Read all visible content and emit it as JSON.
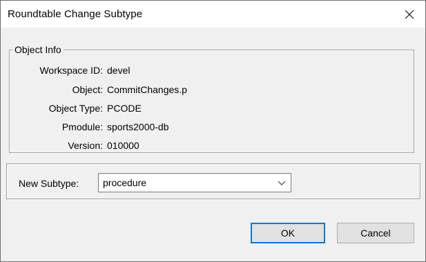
{
  "window": {
    "title": "Roundtable Change Subtype",
    "close_glyph": "✕"
  },
  "object_info": {
    "legend": "Object Info",
    "rows": [
      {
        "label": "Workspace ID:",
        "value": "devel"
      },
      {
        "label": "Object:",
        "value": "CommitChanges.p"
      },
      {
        "label": "Object Type:",
        "value": "PCODE"
      },
      {
        "label": "Pmodule:",
        "value": "sports2000-db"
      },
      {
        "label": "Version:",
        "value": "010000"
      }
    ]
  },
  "subtype": {
    "label": "New Subtype:",
    "selected": "procedure"
  },
  "buttons": {
    "ok": "OK",
    "cancel": "Cancel"
  },
  "icons": {
    "close": "close-icon",
    "dropdown": "chevron-down-icon"
  },
  "colors": {
    "focus_border": "#0078d7",
    "dialog_bg": "#f0f0f0",
    "button_bg": "#e1e1e1"
  }
}
